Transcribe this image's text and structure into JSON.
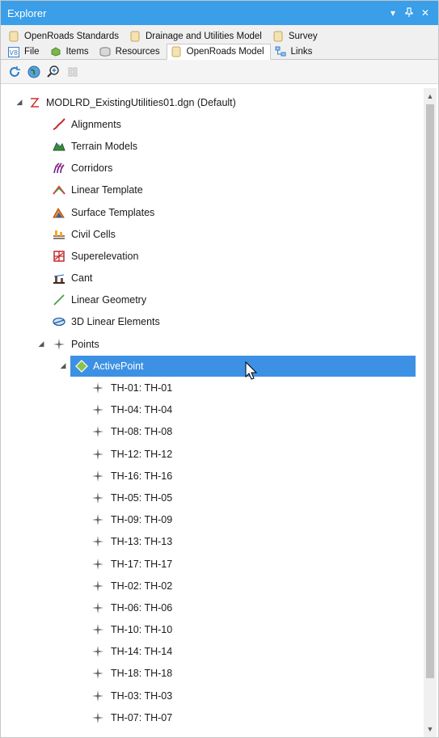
{
  "titlebar": {
    "title": "Explorer",
    "dropdown": "▾",
    "pin": "ᵖ",
    "close": "✕"
  },
  "tabs_row1": [
    {
      "label": "OpenRoads Standards",
      "icon": "database-icon"
    },
    {
      "label": "Drainage and Utilities Model",
      "icon": "database-icon"
    },
    {
      "label": "Survey",
      "icon": "database-icon"
    }
  ],
  "tabs_row2": [
    {
      "label": "File",
      "icon": "v8-file-icon"
    },
    {
      "label": "Items",
      "icon": "items-icon"
    },
    {
      "label": "Resources",
      "icon": "resources-icon"
    },
    {
      "label": "OpenRoads Model",
      "icon": "database-icon",
      "active": true
    },
    {
      "label": "Links",
      "icon": "links-icon"
    }
  ],
  "toolbar": {
    "tools": [
      "refresh-icon",
      "globe-icon",
      "zoom-icon",
      "filter-icon"
    ]
  },
  "tree": {
    "root": "MODLRD_ExistingUtilities01.dgn (Default)",
    "categories": [
      "Alignments",
      "Terrain Models",
      "Corridors",
      "Linear Template",
      "Surface Templates",
      "Civil Cells",
      "Superelevation",
      "Cant",
      "Linear Geometry",
      "3D Linear Elements"
    ],
    "points_label": "Points",
    "selected_label": "ActivePoint",
    "points": [
      "TH-01: TH-01",
      "TH-04: TH-04",
      "TH-08: TH-08",
      "TH-12: TH-12",
      "TH-16: TH-16",
      "TH-05: TH-05",
      "TH-09: TH-09",
      "TH-13: TH-13",
      "TH-17: TH-17",
      "TH-02: TH-02",
      "TH-06: TH-06",
      "TH-10: TH-10",
      "TH-14: TH-14",
      "TH-18: TH-18",
      "TH-03: TH-03",
      "TH-07: TH-07"
    ]
  },
  "colors": {
    "titlebar": "#3a9ee8",
    "selection": "#3d91e4"
  }
}
